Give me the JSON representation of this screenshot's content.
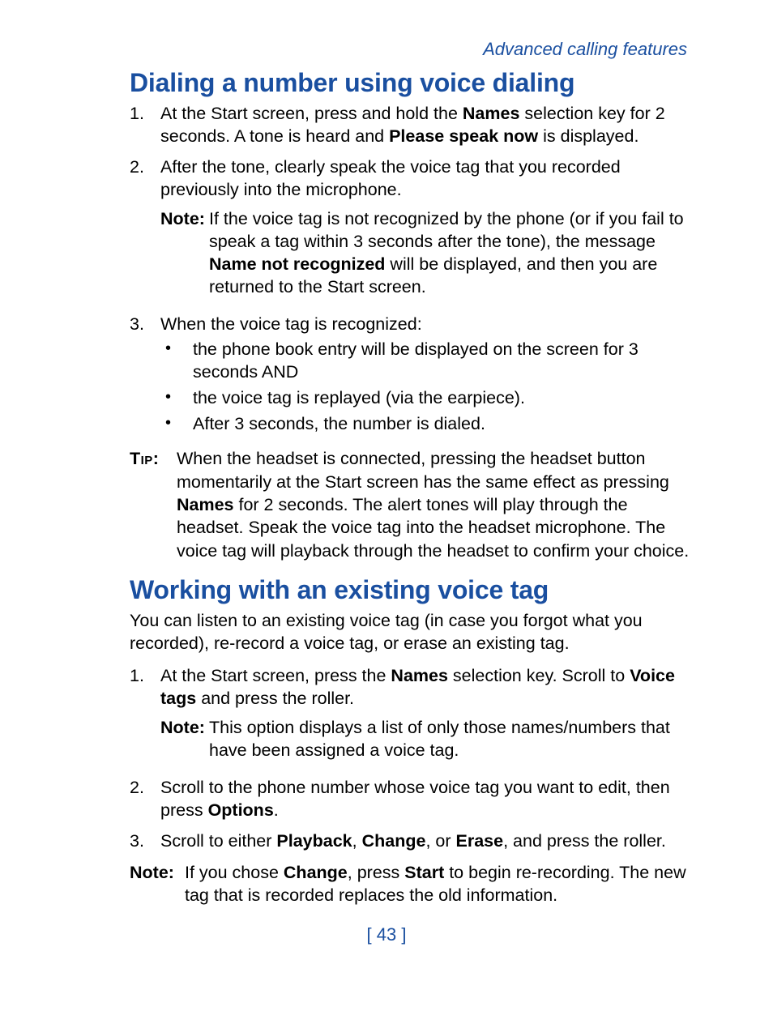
{
  "header": {
    "section_label": "Advanced calling features"
  },
  "section1": {
    "heading": "Dialing a number using voice dialing",
    "step1": {
      "num": "1.",
      "t1": "At the Start screen, press and hold the ",
      "b1": "Names",
      "t2": " selection key for 2 seconds. A tone is heard and ",
      "b2": "Please speak now",
      "t3": " is displayed."
    },
    "step2": {
      "num": "2.",
      "text": "After the tone, clearly speak the voice tag that you recorded previously into the microphone.",
      "note": {
        "label": "Note:",
        "t1": "If the voice tag is not recognized by the phone (or if you fail to speak a tag within 3 seconds after the tone), the message ",
        "b1": "Name not recognized",
        "t2": " will be displayed, and then you are returned to the Start screen."
      }
    },
    "step3": {
      "num": "3.",
      "lead": "When the voice tag is recognized:",
      "bul1": "the phone book entry will be displayed on the screen for 3 seconds AND",
      "bul2": "the voice tag is replayed (via the earpiece).",
      "bul3": "After 3 seconds, the number is dialed."
    },
    "tip": {
      "label": "Tip:",
      "t1": "When the headset is connected, pressing the headset button momentarily at the Start screen has the same effect as pressing ",
      "b1": "Names",
      "t2": " for 2 seconds. The alert tones will play through the headset. Speak the voice tag into the headset microphone. The voice tag will playback through the headset to confirm your choice."
    }
  },
  "section2": {
    "heading": "Working with an existing voice tag",
    "intro": "You can listen to an existing voice tag (in case you forgot what you recorded), re-record a voice tag, or erase an existing tag.",
    "step1": {
      "num": "1.",
      "t1": "At the Start screen, press the ",
      "b1": "Names",
      "t2": " selection key. Scroll to ",
      "b2": "Voice tags",
      "t3": " and press the roller.",
      "note": {
        "label": "Note:",
        "text": "This option displays a list of only those names/numbers that have been assigned a voice tag."
      }
    },
    "step2": {
      "num": "2.",
      "t1": "Scroll to the phone number whose voice tag you want to edit, then press ",
      "b1": "Options",
      "t2": "."
    },
    "step3": {
      "num": "3.",
      "t1": "Scroll to either ",
      "b1": "Playback",
      "t2": ", ",
      "b2": "Change",
      "t3": ", or ",
      "b3": "Erase",
      "t4": ", and press the roller."
    },
    "note": {
      "label": "Note:",
      "t1": "If you chose ",
      "b1": "Change",
      "t2": ", press ",
      "b2": "Start",
      "t3": " to begin re-recording. The new tag that is recorded replaces the old information."
    }
  },
  "footer": {
    "page_number": "[ 43 ]"
  }
}
